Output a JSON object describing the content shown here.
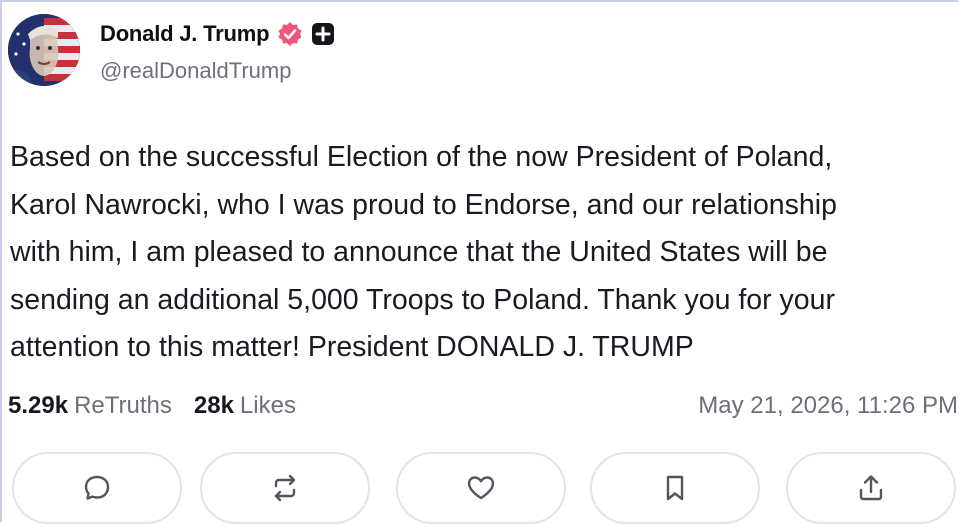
{
  "post": {
    "author": {
      "display_name": "Donald J. Trump",
      "handle": "@realDonaldTrump",
      "verified_icon": "verified-check-icon",
      "plus_icon": "plus-square-icon"
    },
    "text_lines": [
      "Based on the successful Election of the now President of Poland,",
      "Karol Nawrocki, who I was proud to Endorse, and our relationship",
      "with him, I am pleased to announce that the United States will be",
      "sending an additional 5,000 Troops to Poland. Thank you for your",
      "attention to this matter! President DONALD J. TRUMP"
    ],
    "stats": {
      "retruths_count": "5.29k",
      "retruths_label": "ReTruths",
      "likes_count": "28k",
      "likes_label": "Likes"
    },
    "timestamp": "May 21, 2026, 11:26 PM"
  },
  "actions": [
    {
      "name": "reply",
      "icon": "comment-bubble-icon"
    },
    {
      "name": "retruth",
      "icon": "repost-arrows-icon"
    },
    {
      "name": "like",
      "icon": "heart-icon"
    },
    {
      "name": "bookmark",
      "icon": "bookmark-icon"
    },
    {
      "name": "share",
      "icon": "share-upload-icon"
    }
  ],
  "colors": {
    "verified_badge": "#f2557a",
    "text_primary": "#1a1a22",
    "text_secondary": "#6f6f7a",
    "button_border": "#e3e3ea"
  }
}
